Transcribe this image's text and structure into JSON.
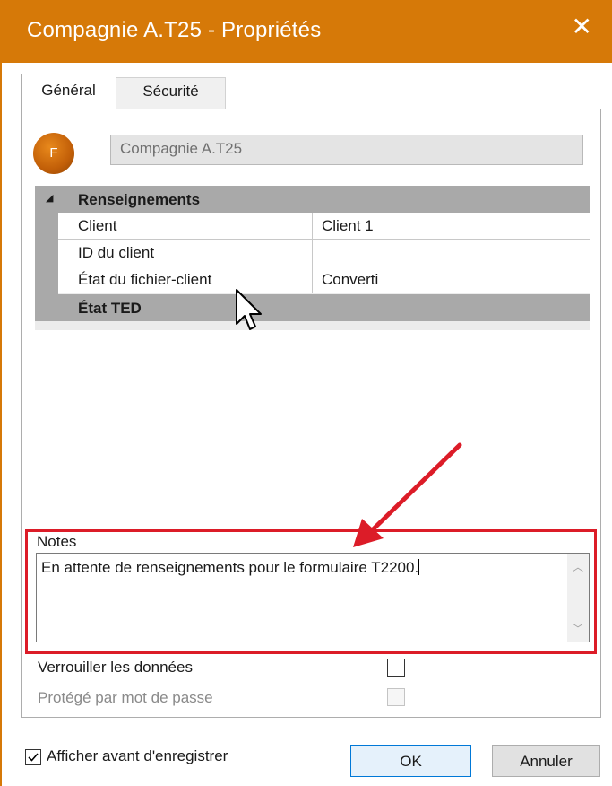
{
  "window": {
    "title": "Compagnie A.T25 - Propriétés",
    "close_glyph": "✕",
    "accent": "#d67908"
  },
  "tabs": [
    {
      "label": "Général",
      "active": true
    },
    {
      "label": "Sécurité",
      "active": false
    }
  ],
  "avatar": {
    "letter": "F"
  },
  "name_field": {
    "value": "Compagnie A.T25"
  },
  "properties": {
    "group_collapse_glyph": "◢",
    "group1": "Renseignements",
    "rows": [
      {
        "label": "Client",
        "value": "Client 1"
      },
      {
        "label": "ID du client",
        "value": ""
      },
      {
        "label": "État du fichier-client",
        "value": "Converti"
      }
    ],
    "group2": "État TED"
  },
  "notes": {
    "label": "Notes",
    "value": "En attente de renseignements pour le formulaire T2200.",
    "highlight_color": "#dc1c28"
  },
  "lock_data": {
    "label": "Verrouiller les données",
    "checked": false
  },
  "password_protected": {
    "label": "Protégé par mot de passe",
    "checked": false,
    "enabled": false
  },
  "footer": {
    "show_before_save": {
      "label": "Afficher avant d'enregistrer",
      "checked": true
    },
    "ok_label": "OK",
    "cancel_label": "Annuler"
  }
}
